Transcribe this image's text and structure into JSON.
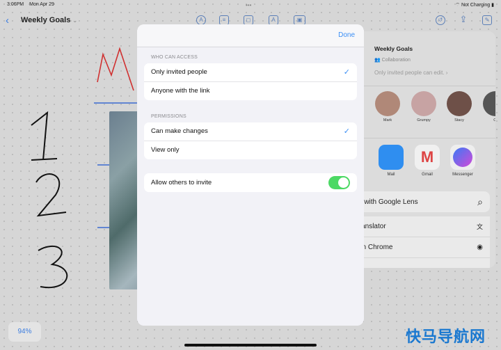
{
  "status": {
    "time": "3:06PM",
    "date": "Mon Apr 29",
    "battery": "Not Charging",
    "dots": "•••"
  },
  "toolbar": {
    "title": "Weekly Goals",
    "back_icon": "chevron-left-icon",
    "title_menu": "⌄"
  },
  "share": {
    "title": "Weekly Goals",
    "subtitle": "Collaboration",
    "permission_summary": "Only invited people can edit. ›",
    "people": [
      {
        "name": "Mark",
        "color": "#b08878"
      },
      {
        "name": "Grumpy",
        "color": "#c7a3a3"
      },
      {
        "name": "Stacy",
        "color": "#6e5048"
      },
      {
        "name": "Ol",
        "color": "#555"
      }
    ],
    "apps": [
      {
        "name": "Mail",
        "color": "#2f8ef0"
      },
      {
        "name": "Gmail",
        "color": "#f0f0f0"
      },
      {
        "name": "Messenger",
        "color": "#8a4df0"
      }
    ],
    "actions": [
      {
        "label": "ch with Google Lens",
        "icon": "search-icon",
        "glyph": "⌕"
      },
      {
        "label": " Translator",
        "icon": "translate-icon",
        "glyph": "文"
      },
      {
        "label": "n in Chrome",
        "icon": "chrome-icon",
        "glyph": "◉"
      }
    ]
  },
  "modal": {
    "done": "Done",
    "who_header": "WHO CAN ACCESS",
    "who_options": [
      {
        "label": "Only invited people",
        "checked": true
      },
      {
        "label": "Anyone with the link",
        "checked": false
      }
    ],
    "perm_header": "PERMISSIONS",
    "perm_options": [
      {
        "label": "Can make changes",
        "checked": true
      },
      {
        "label": "View only",
        "checked": false
      }
    ],
    "allow_invite": {
      "label": "Allow others to invite",
      "on": true
    }
  },
  "zoom_level": "94%",
  "watermark": "快马导航网"
}
